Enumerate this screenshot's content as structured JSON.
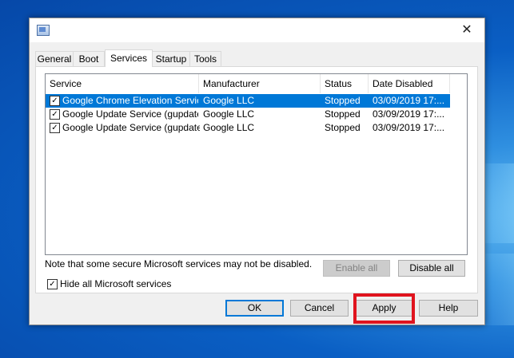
{
  "window": {
    "close_glyph": "✕"
  },
  "tabs": [
    {
      "label": "General",
      "active": false
    },
    {
      "label": "Boot",
      "active": false
    },
    {
      "label": "Services",
      "active": true
    },
    {
      "label": "Startup",
      "active": false
    },
    {
      "label": "Tools",
      "active": false
    }
  ],
  "services_table": {
    "columns": [
      "Service",
      "Manufacturer",
      "Status",
      "Date Disabled"
    ],
    "rows": [
      {
        "checked": true,
        "selected": true,
        "service": "Google Chrome Elevation Service",
        "manufacturer": "Google LLC",
        "status": "Stopped",
        "date_disabled": "03/09/2019 17:..."
      },
      {
        "checked": true,
        "selected": false,
        "service": "Google Update Service (gupdate)",
        "manufacturer": "Google LLC",
        "status": "Stopped",
        "date_disabled": "03/09/2019 17:..."
      },
      {
        "checked": true,
        "selected": false,
        "service": "Google Update Service (gupdatem)",
        "manufacturer": "Google LLC",
        "status": "Stopped",
        "date_disabled": "03/09/2019 17:..."
      }
    ]
  },
  "note": "Note that some secure Microsoft services may not be disabled.",
  "enable_all_label": "Enable all",
  "disable_all_label": "Disable all",
  "hide_ms": {
    "label": "Hide all Microsoft services",
    "checked": true
  },
  "buttons": {
    "ok": "OK",
    "cancel": "Cancel",
    "apply": "Apply",
    "help": "Help"
  },
  "colors": {
    "selection": "#0078d7",
    "highlight_box": "#e0141e"
  }
}
